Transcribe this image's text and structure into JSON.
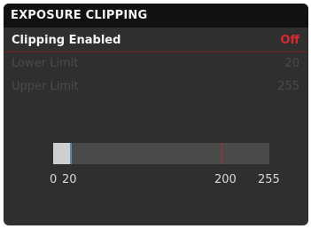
{
  "screen": {
    "title": "EXPOSURE CLIPPING"
  },
  "menu": {
    "clipping_enabled": {
      "label": "Clipping Enabled",
      "value": "Off"
    },
    "lower_limit": {
      "label": "Lower Limit",
      "value": "20"
    },
    "upper_limit": {
      "label": "Upper Limit",
      "value": "255"
    }
  },
  "range": {
    "min": 0,
    "max": 255,
    "lower": 20,
    "upper": 200,
    "labels": {
      "min": "0",
      "lower": "20",
      "upper": "200",
      "max": "255"
    }
  },
  "colors": {
    "accent": "#d62a2f",
    "marker_blue": "#5f84ad",
    "marker_red": "#b1272b"
  }
}
